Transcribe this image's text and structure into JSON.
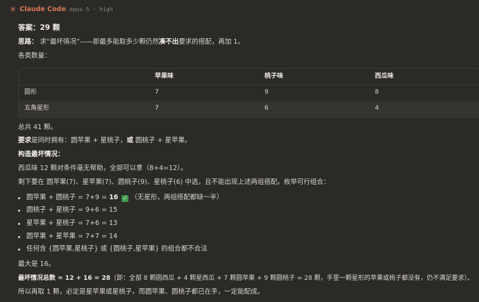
{
  "header": {
    "app_name": "Claude Code",
    "model_info": "opus-5 · high"
  },
  "answer": "答案：29 颗",
  "idea": {
    "label": "思路：",
    "text_a": "求“最坏情况”——即最多能取多少颗仍然",
    "bold": "凑不出",
    "text_b": "要求的搭配，再加 1。"
  },
  "counts_label": "各类数量：",
  "table": {
    "headers": [
      "",
      "苹果味",
      "桃子味",
      "西瓜味"
    ],
    "rows": [
      [
        "圆形",
        "7",
        "9",
        "8"
      ],
      [
        "五角星形",
        "7",
        "6",
        "4"
      ]
    ]
  },
  "total": "总共 41 颗。",
  "requirement": {
    "label": "要求",
    "text_a": "是同时拥有：圆苹果 + 星桃子，",
    "bold": "或",
    "text_b": " 圆桃子 + 星苹果。"
  },
  "construct_heading": "构造最坏情况：",
  "watermelon_line": "西瓜味 12 颗对条件毫无帮助，全部可以拿（8+4=12）。",
  "remaining_line": "剩下要在 圆苹果(7)、星苹果(7)、圆桃子(9)、星桃子(6) 中选，且不能出现上述两组搭配。枚举可行组合：",
  "options": [
    {
      "text": "圆苹果 + 圆桃子 = 7+9 = ",
      "bold": "16",
      "check": "✓",
      "note": "（无星形，两组搭配都缺一半）"
    },
    {
      "text": "圆桃子 + 星桃子 = 9+6 = 15"
    },
    {
      "text": "星苹果 + 星桃子 = 7+6 = 13"
    },
    {
      "text": "圆苹果 + 星苹果 = 7+7 = 14"
    },
    {
      "text": "任何含 {圆苹果,星桃子} 或 {圆桃子,星苹果} 的组合都不合法"
    }
  ],
  "max_line": "最大是 16。",
  "worst_total": {
    "bold": "最坏情况总数 = 12 + 16 = 28",
    "text": "（即：全部 8 颗圆西瓜 + 4 颗星西瓜 + 7 颗圆苹果 + 9 颗圆桃子 = 28 颗，手里一颗星形的苹果或桃子都没有，仍不满足要求）。"
  },
  "conclusion": "所以再取 1 颗，必定是星苹果或星桃子，而圆苹果、圆桃子都已在手，一定能配成。",
  "colors": {
    "background": "#2b2a27",
    "accent": "#d97757",
    "check": "#3f9a4b"
  }
}
